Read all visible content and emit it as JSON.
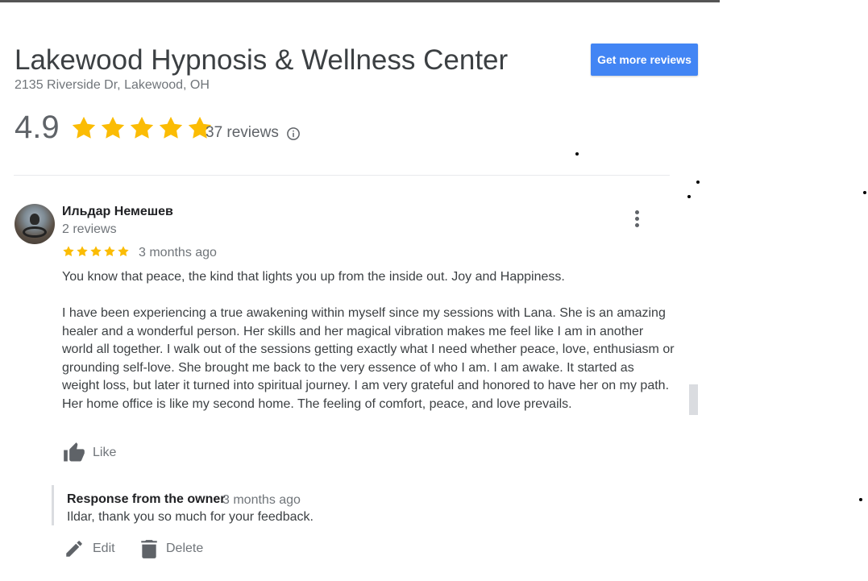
{
  "business": {
    "name": "Lakewood Hypnosis & Wellness Center",
    "address": "2135 Riverside Dr, Lakewood, OH",
    "cta_label": "Get more reviews",
    "rating": "4.9",
    "star_count": 5,
    "reviews_count": "37 reviews"
  },
  "review": {
    "reviewer_name": "Ильдар Немешев",
    "reviewer_reviews": "2 reviews",
    "stars": 5,
    "date": "3 months ago",
    "paragraph1": "You know that peace, the kind that lights you up from the inside out. Joy and Happiness.",
    "paragraph2": "I have been experiencing a true awakening within myself since my sessions with Lana. She is an amazing healer and a wonderful person. Her skills and her magical vibration makes me feel like I am in another world all together. I walk out of the sessions getting exactly what I need whether peace, love, enthusiasm or grounding self-love. She brought me back to the very essence of who I am. I am awake. It started as weight loss, but later it turned into spiritual journey. I am very grateful and honored to have her on my path.",
    "paragraph3": "Her home office is like my second home. The feeling of comfort, peace, and love prevails.",
    "like_label": "Like"
  },
  "owner_response": {
    "title": "Response from the owner",
    "date": "3 months ago",
    "text": "Ildar, thank you so much for your feedback.",
    "edit_label": "Edit",
    "delete_label": "Delete"
  },
  "colors": {
    "accent": "#4285f4",
    "star": "#fbbc04",
    "muted_text": "#70757a"
  },
  "icons": [
    "star-icon",
    "info-icon",
    "more-vert-icon",
    "thumb-up-icon",
    "pencil-icon",
    "trash-icon"
  ]
}
